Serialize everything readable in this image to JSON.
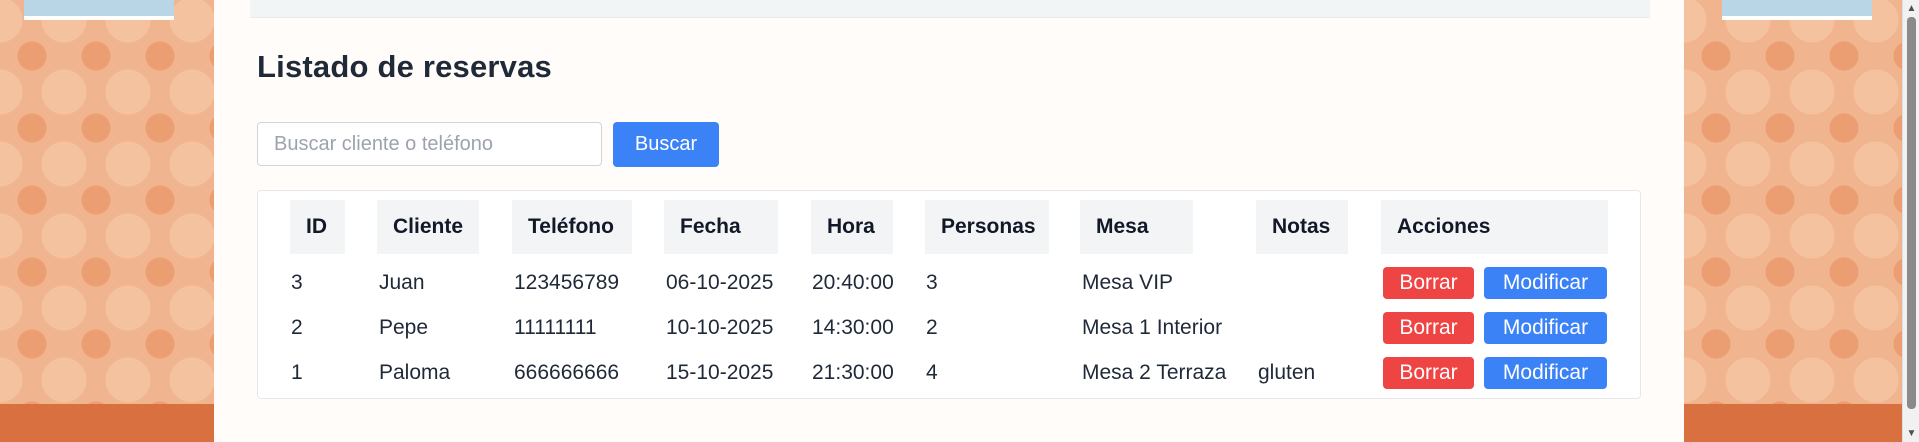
{
  "page": {
    "title": "Listado de reservas"
  },
  "search": {
    "placeholder": "Buscar cliente o teléfono",
    "value": "",
    "button_label": "Buscar"
  },
  "table": {
    "columns": [
      "ID",
      "Cliente",
      "Teléfono",
      "Fecha",
      "Hora",
      "Personas",
      "Mesa",
      "Notas",
      "Acciones"
    ],
    "rows": [
      {
        "id": "3",
        "cliente": "Juan",
        "telefono": "123456789",
        "fecha": "06-10-2025",
        "hora": "20:40:00",
        "personas": "3",
        "mesa": "Mesa VIP",
        "notas": ""
      },
      {
        "id": "2",
        "cliente": "Pepe",
        "telefono": "11111111",
        "fecha": "10-10-2025",
        "hora": "14:30:00",
        "personas": "2",
        "mesa": "Mesa 1 Interior",
        "notas": ""
      },
      {
        "id": "1",
        "cliente": "Paloma",
        "telefono": "666666666",
        "fecha": "15-10-2025",
        "hora": "21:30:00",
        "personas": "4",
        "mesa": "Mesa 2 Terraza",
        "notas": "gluten"
      }
    ],
    "delete_label": "Borrar",
    "edit_label": "Modificar"
  },
  "colors": {
    "primary": "#3b82f6",
    "danger": "#ef4444",
    "text": "#1f2937",
    "header_bg": "#f3f4f6"
  },
  "icons": {
    "scroll_up": "scroll-up-arrow-icon",
    "scroll_down": "scroll-down-arrow-icon"
  }
}
